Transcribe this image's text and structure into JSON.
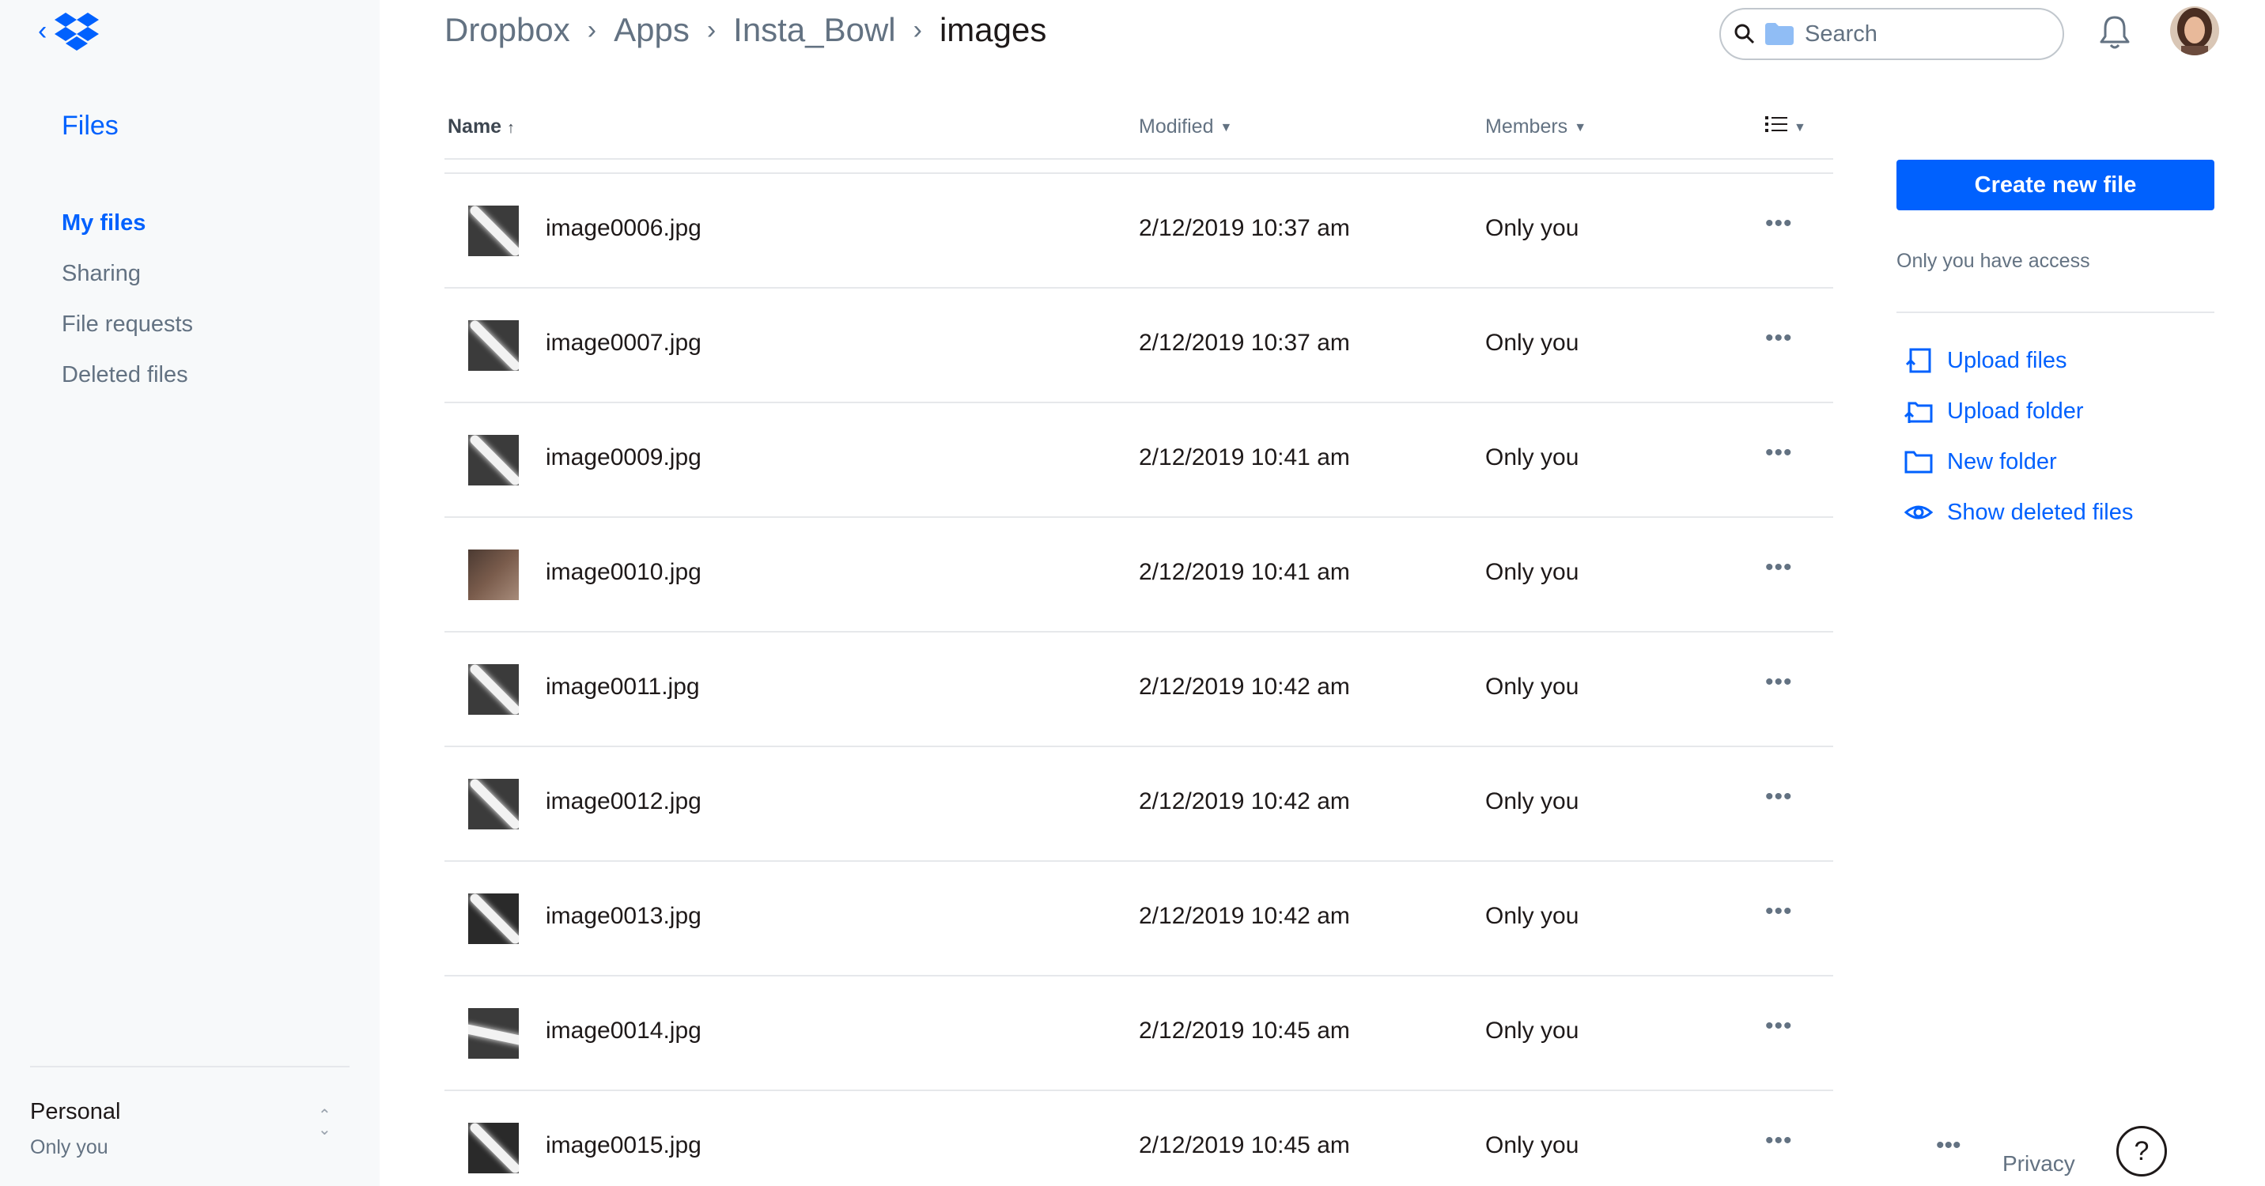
{
  "sidebar": {
    "back_icon": "chevron-left-icon",
    "logo": "dropbox-logo",
    "title": "Files",
    "nav": [
      {
        "label": "My files",
        "active": true
      },
      {
        "label": "Sharing",
        "active": false
      },
      {
        "label": "File requests",
        "active": false
      },
      {
        "label": "Deleted files",
        "active": false
      }
    ],
    "account": {
      "name": "Personal",
      "sub": "Only you"
    }
  },
  "header": {
    "breadcrumb": [
      "Dropbox",
      "Apps",
      "Insta_Bowl",
      "images"
    ],
    "search_placeholder": "Search"
  },
  "table": {
    "columns": {
      "name": "Name",
      "modified": "Modified",
      "members": "Members"
    },
    "sort_indicator": "↑",
    "rows": [
      {
        "name": "image0006.jpg",
        "modified": "2/12/2019 10:37 am",
        "members": "Only you",
        "thumb": "streak"
      },
      {
        "name": "image0007.jpg",
        "modified": "2/12/2019 10:37 am",
        "members": "Only you",
        "thumb": "streak"
      },
      {
        "name": "image0009.jpg",
        "modified": "2/12/2019 10:41 am",
        "members": "Only you",
        "thumb": "streak"
      },
      {
        "name": "image0010.jpg",
        "modified": "2/12/2019 10:41 am",
        "members": "Only you",
        "thumb": "face"
      },
      {
        "name": "image0011.jpg",
        "modified": "2/12/2019 10:42 am",
        "members": "Only you",
        "thumb": "streak"
      },
      {
        "name": "image0012.jpg",
        "modified": "2/12/2019 10:42 am",
        "members": "Only you",
        "thumb": "streak"
      },
      {
        "name": "image0013.jpg",
        "modified": "2/12/2019 10:42 am",
        "members": "Only you",
        "thumb": "dark"
      },
      {
        "name": "image0014.jpg",
        "modified": "2/12/2019 10:45 am",
        "members": "Only you",
        "thumb": "flat"
      },
      {
        "name": "image0015.jpg",
        "modified": "2/12/2019 10:45 am",
        "members": "Only you",
        "thumb": "dark"
      }
    ],
    "more_label": "•••"
  },
  "panel": {
    "create_label": "Create new file",
    "access_text": "Only you have access",
    "actions": [
      {
        "label": "Upload files",
        "icon": "upload-files-icon"
      },
      {
        "label": "Upload folder",
        "icon": "upload-folder-icon"
      },
      {
        "label": "New folder",
        "icon": "new-folder-icon"
      },
      {
        "label": "Show deleted files",
        "icon": "eye-icon"
      }
    ]
  },
  "footer": {
    "more": "•••",
    "privacy": "Privacy",
    "help": "?"
  },
  "colors": {
    "accent": "#0061fe",
    "muted": "#637282",
    "sidebar_bg": "#f7f9fa"
  }
}
